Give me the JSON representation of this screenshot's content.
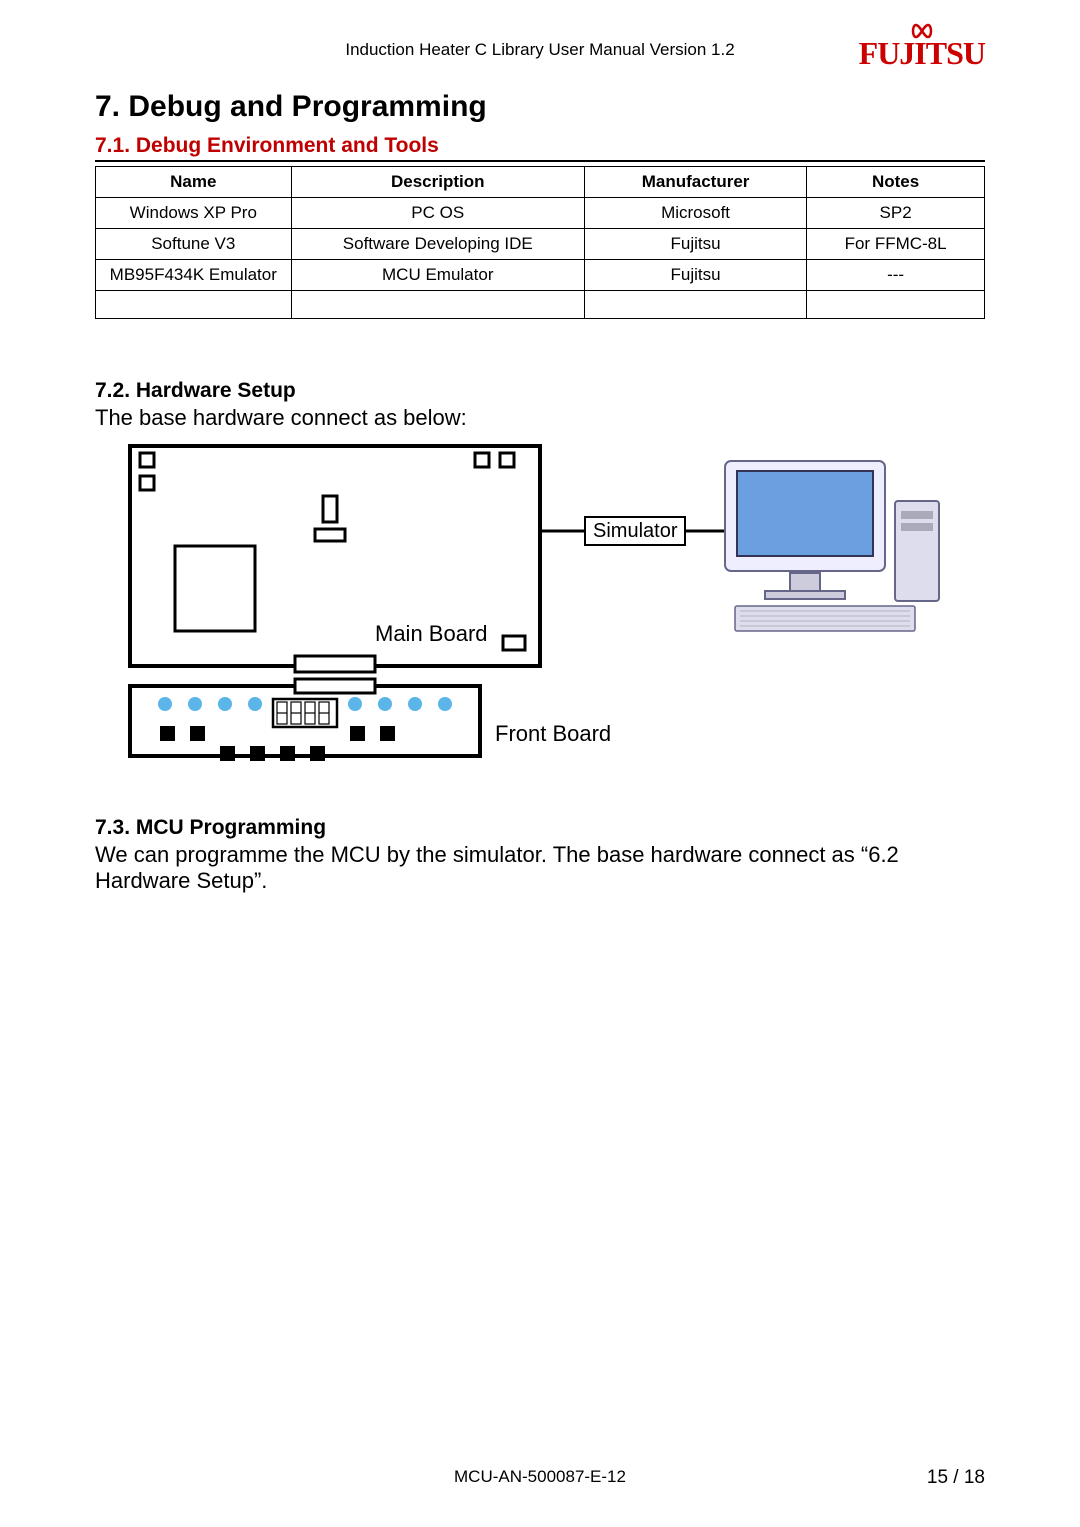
{
  "header": {
    "title": "Induction Heater C Library User Manual Version 1.2",
    "brand": "FUJITSU"
  },
  "heading_main": "7. Debug and Programming",
  "section1": {
    "title": "7.1. Debug Environment and Tools",
    "table": {
      "headers": [
        "Name",
        "Description",
        "Manufacturer",
        "Notes"
      ],
      "rows": [
        [
          "Windows XP Pro",
          "PC OS",
          "Microsoft",
          "SP2"
        ],
        [
          "Softune V3",
          "Software Developing IDE",
          "Fujitsu",
          "For FFMC-8L"
        ],
        [
          "MB95F434K Emulator",
          "MCU Emulator",
          "Fujitsu",
          "---"
        ],
        [
          "",
          "",
          "",
          ""
        ]
      ]
    }
  },
  "section2": {
    "title": "7.2. Hardware Setup",
    "text": "The base hardware connect as below:",
    "diagram": {
      "labels": {
        "main_board": "Main Board",
        "simulator": "Simulator",
        "front_board": "Front Board"
      }
    }
  },
  "section3": {
    "title": "7.3. MCU Programming",
    "text": "We can programme the MCU by the simulator. The base hardware connect as “6.2 Hardware Setup”."
  },
  "footer": {
    "docnum": "MCU-AN-500087-E-12",
    "page": "15 / 18"
  }
}
